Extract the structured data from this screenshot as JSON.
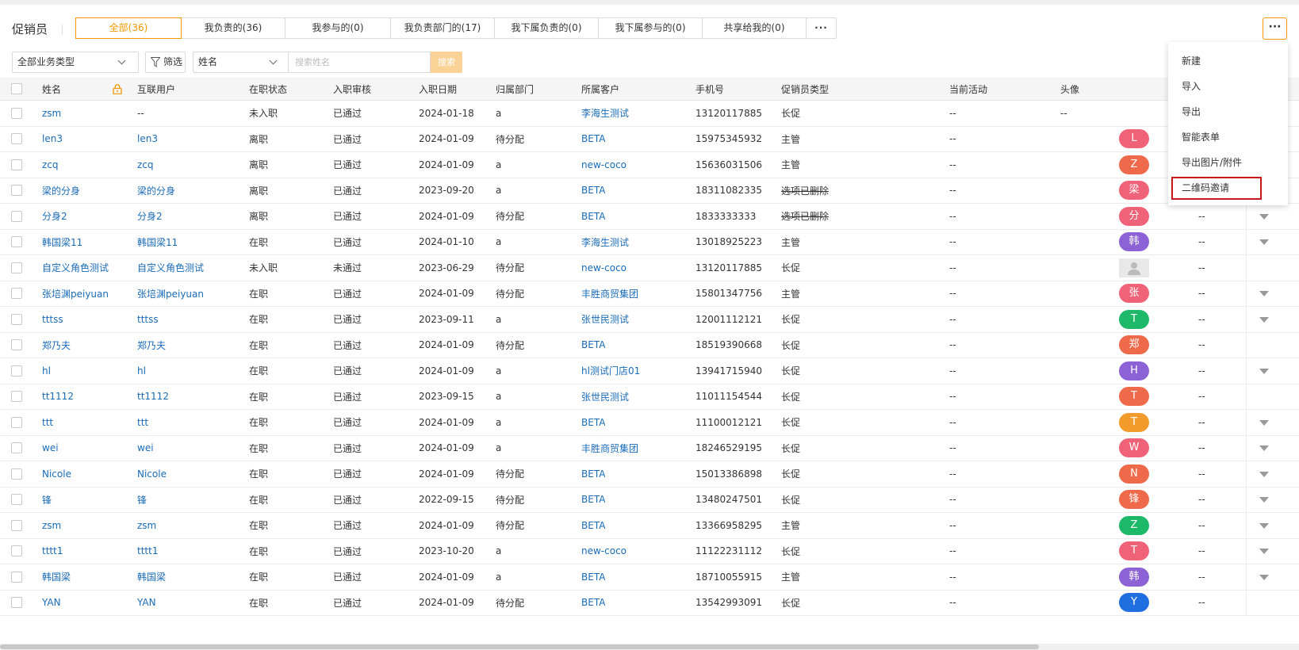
{
  "page_title": "促销员",
  "tabs": [
    {
      "label": "全部(36)",
      "active": true
    },
    {
      "label": "我负责的(36)"
    },
    {
      "label": "我参与的(0)"
    },
    {
      "label": "我负责部门的(17)"
    },
    {
      "label": "我下属负责的(0)"
    },
    {
      "label": "我下属参与的(0)"
    },
    {
      "label": "共享给我的(0)"
    },
    {
      "label": "···"
    }
  ],
  "more_button": "···",
  "dropdown_menu": [
    "新建",
    "导入",
    "导出",
    "智能表单",
    "导出图片/附件",
    "二维码邀请"
  ],
  "filters": {
    "biz_type": "全部业务类型",
    "filter_label": "筛选",
    "field_select": "姓名",
    "search_placeholder": "搜索姓名",
    "search_button": "搜索"
  },
  "columns": [
    "姓名",
    "互联用户",
    "在职状态",
    "入职审核",
    "入职日期",
    "归属部门",
    "所属客户",
    "手机号",
    "促销员类型",
    "当前活动",
    "头像"
  ],
  "rows": [
    {
      "name": "zsm",
      "user": "--",
      "status": "未入职",
      "audit": "已通过",
      "date": "2024-01-18",
      "dept": "a",
      "customer": "李海生测试",
      "phone": "13120117885",
      "type": "长促",
      "type_strike": false,
      "activity": "--",
      "avatar": "--",
      "avatar_color": "",
      "caret": false
    },
    {
      "name": "len3",
      "user": "len3",
      "status": "离职",
      "audit": "已通过",
      "date": "2024-01-09",
      "dept": "待分配",
      "customer": "BETA",
      "phone": "15975345932",
      "type": "主管",
      "type_strike": false,
      "activity": "--",
      "avatar": "L",
      "avatar_color": "#f06277",
      "caret": false
    },
    {
      "name": "zcq",
      "user": "zcq",
      "status": "离职",
      "audit": "已通过",
      "date": "2024-01-09",
      "dept": "a",
      "customer": "new-coco",
      "phone": "15636031506",
      "type": "主管",
      "type_strike": false,
      "activity": "--",
      "avatar": "Z",
      "avatar_color": "#ee6a4b",
      "caret": false
    },
    {
      "name": "梁的分身",
      "user": "梁的分身",
      "status": "离职",
      "audit": "已通过",
      "date": "2023-09-20",
      "dept": "a",
      "customer": "BETA",
      "phone": "18311082335",
      "type": "选项已删除",
      "type_strike": true,
      "activity": "--",
      "avatar": "梁",
      "avatar_color": "#f06277",
      "caret": false
    },
    {
      "name": "分身2",
      "user": "分身2",
      "status": "离职",
      "audit": "已通过",
      "date": "2024-01-09",
      "dept": "待分配",
      "customer": "BETA",
      "phone": "1833333333",
      "type": "选项已删除",
      "type_strike": true,
      "activity": "--",
      "avatar": "分",
      "avatar_color": "#f06277",
      "caret": true
    },
    {
      "name": "韩国梁11",
      "user": "韩国梁11",
      "status": "在职",
      "audit": "已通过",
      "date": "2024-01-10",
      "dept": "a",
      "customer": "李海生测试",
      "phone": "13018925223",
      "type": "主管",
      "type_strike": false,
      "activity": "--",
      "avatar": "韩",
      "avatar_color": "#8c62d6",
      "caret": true
    },
    {
      "name": "自定义角色测试",
      "user": "自定义角色测试",
      "status": "未入职",
      "audit": "未通过",
      "date": "2023-06-29",
      "dept": "待分配",
      "customer": "new-coco",
      "phone": "13120117885",
      "type": "长促",
      "type_strike": false,
      "activity": "--",
      "avatar": "",
      "avatar_color": "",
      "caret": false
    },
    {
      "name": "张培渊peiyuan",
      "user": "张培渊peiyuan",
      "status": "在职",
      "audit": "已通过",
      "date": "2024-01-09",
      "dept": "待分配",
      "customer": "丰胜商贸集团",
      "phone": "15801347756",
      "type": "主管",
      "type_strike": false,
      "activity": "--",
      "avatar": "张",
      "avatar_color": "#f06277",
      "caret": true
    },
    {
      "name": "tttss",
      "user": "tttss",
      "status": "在职",
      "audit": "已通过",
      "date": "2023-09-11",
      "dept": "a",
      "customer": "张世民测试",
      "phone": "12001112121",
      "type": "长促",
      "type_strike": false,
      "activity": "--",
      "avatar": "T",
      "avatar_color": "#1db968",
      "caret": true
    },
    {
      "name": "郑乃夫",
      "user": "郑乃夫",
      "status": "在职",
      "audit": "已通过",
      "date": "2024-01-09",
      "dept": "待分配",
      "customer": "BETA",
      "phone": "18519390668",
      "type": "长促",
      "type_strike": false,
      "activity": "--",
      "avatar": "郑",
      "avatar_color": "#ee6a4b",
      "caret": false
    },
    {
      "name": "hl",
      "user": "hl",
      "status": "在职",
      "audit": "已通过",
      "date": "2024-01-09",
      "dept": "a",
      "customer": "hl测试门店01",
      "phone": "13941715940",
      "type": "长促",
      "type_strike": false,
      "activity": "--",
      "avatar": "H",
      "avatar_color": "#8c62d6",
      "caret": true
    },
    {
      "name": "tt1112",
      "user": "tt1112",
      "status": "在职",
      "audit": "已通过",
      "date": "2023-09-15",
      "dept": "a",
      "customer": "张世民测试",
      "phone": "11011154544",
      "type": "长促",
      "type_strike": false,
      "activity": "--",
      "avatar": "T",
      "avatar_color": "#ee6a4b",
      "caret": false
    },
    {
      "name": "ttt",
      "user": "ttt",
      "status": "在职",
      "audit": "已通过",
      "date": "2024-01-09",
      "dept": "a",
      "customer": "BETA",
      "phone": "11100012121",
      "type": "长促",
      "type_strike": false,
      "activity": "--",
      "avatar": "T",
      "avatar_color": "#f39b2b",
      "caret": true
    },
    {
      "name": "wei",
      "user": "wei",
      "status": "在职",
      "audit": "已通过",
      "date": "2024-01-09",
      "dept": "a",
      "customer": "丰胜商贸集团",
      "phone": "18246529195",
      "type": "长促",
      "type_strike": false,
      "activity": "--",
      "avatar": "W",
      "avatar_color": "#f06277",
      "caret": true
    },
    {
      "name": "Nicole",
      "user": "Nicole",
      "status": "在职",
      "audit": "已通过",
      "date": "2024-01-09",
      "dept": "待分配",
      "customer": "BETA",
      "phone": "15013386898",
      "type": "长促",
      "type_strike": false,
      "activity": "--",
      "avatar": "N",
      "avatar_color": "#ee6a4b",
      "caret": true
    },
    {
      "name": "锋",
      "user": "锋",
      "status": "在职",
      "audit": "已通过",
      "date": "2022-09-15",
      "dept": "待分配",
      "customer": "BETA",
      "phone": "13480247501",
      "type": "长促",
      "type_strike": false,
      "activity": "--",
      "avatar": "锋",
      "avatar_color": "#ee6a4b",
      "caret": true
    },
    {
      "name": "zsm",
      "user": "zsm",
      "status": "在职",
      "audit": "已通过",
      "date": "2024-01-09",
      "dept": "待分配",
      "customer": "BETA",
      "phone": "13366958295",
      "type": "主管",
      "type_strike": false,
      "activity": "--",
      "avatar": "Z",
      "avatar_color": "#1db968",
      "caret": true
    },
    {
      "name": "tttt1",
      "user": "tttt1",
      "status": "在职",
      "audit": "已通过",
      "date": "2023-10-20",
      "dept": "a",
      "customer": "new-coco",
      "phone": "11122231112",
      "type": "长促",
      "type_strike": false,
      "activity": "--",
      "avatar": "T",
      "avatar_color": "#f06277",
      "caret": true
    },
    {
      "name": "韩国梁",
      "user": "韩国梁",
      "status": "在职",
      "audit": "已通过",
      "date": "2024-01-09",
      "dept": "a",
      "customer": "BETA",
      "phone": "18710055915",
      "type": "主管",
      "type_strike": false,
      "activity": "--",
      "avatar": "韩",
      "avatar_color": "#8c62d6",
      "caret": true
    },
    {
      "name": "YAN",
      "user": "YAN",
      "status": "在职",
      "audit": "已通过",
      "date": "2024-01-09",
      "dept": "待分配",
      "customer": "BETA",
      "phone": "13542993091",
      "type": "长促",
      "type_strike": false,
      "activity": "--",
      "avatar": "Y",
      "avatar_color": "#1f6fe0",
      "caret": false
    }
  ],
  "colors": {
    "accent": "#f39800",
    "link": "#1a6bb8",
    "highlight": "#c8161d"
  }
}
